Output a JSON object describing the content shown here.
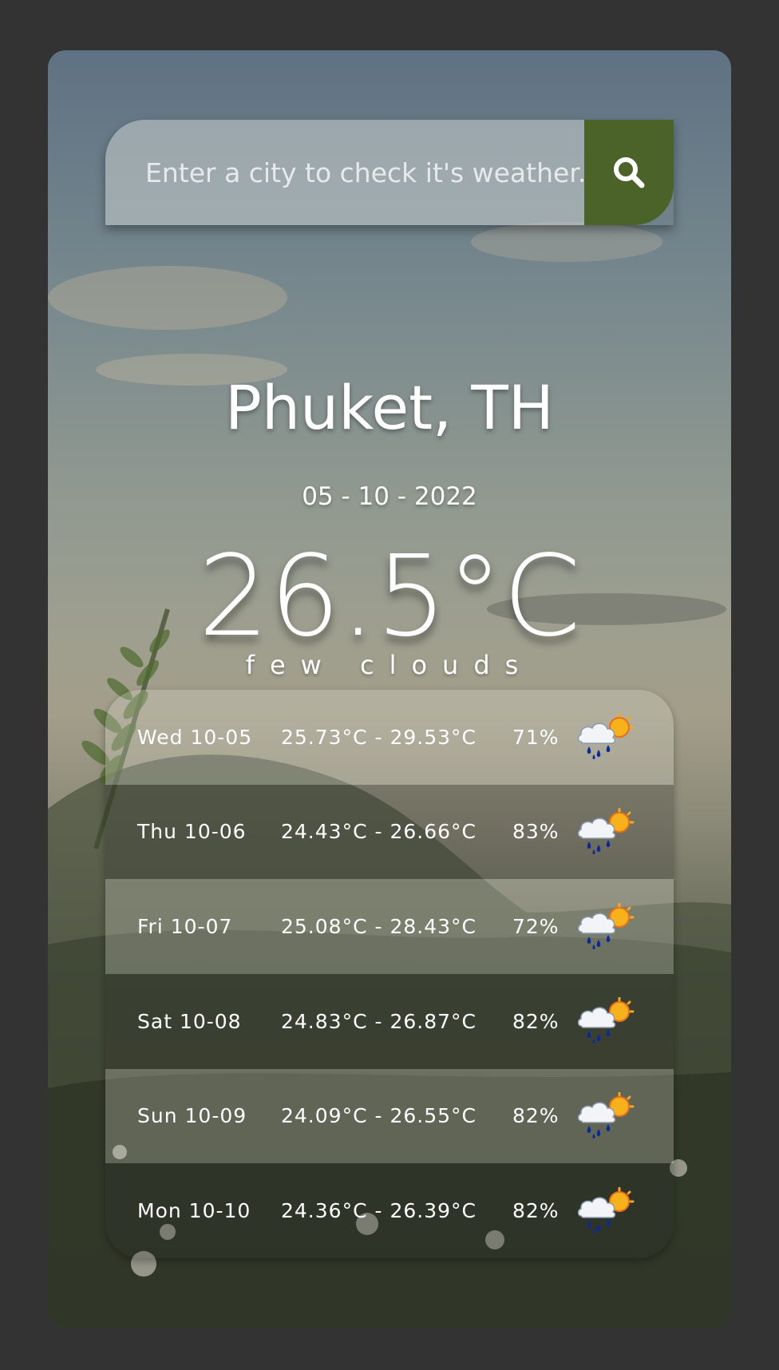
{
  "search": {
    "placeholder": "Enter a city to check it's weather...",
    "button_icon": "search-icon"
  },
  "current": {
    "city": "Phuket, TH",
    "date": "05 - 10 - 2022",
    "temperature": "26.5°C",
    "description": "few clouds"
  },
  "forecast": [
    {
      "day": "Wed 10-05",
      "range": "25.73°C - 29.53°C",
      "humidity": "71%",
      "icon": "rain-sun-icon"
    },
    {
      "day": "Thu 10-06",
      "range": "24.43°C - 26.66°C",
      "humidity": "83%",
      "icon": "rain-sun-icon"
    },
    {
      "day": "Fri 10-07",
      "range": "25.08°C - 28.43°C",
      "humidity": "72%",
      "icon": "rain-sun-icon"
    },
    {
      "day": "Sat 10-08",
      "range": "24.83°C - 26.87°C",
      "humidity": "82%",
      "icon": "rain-sun-icon"
    },
    {
      "day": "Sun 10-09",
      "range": "24.09°C - 26.55°C",
      "humidity": "82%",
      "icon": "rain-sun-icon"
    },
    {
      "day": "Mon 10-10",
      "range": "24.36°C - 26.39°C",
      "humidity": "82%",
      "icon": "rain-sun-icon"
    }
  ],
  "colors": {
    "page_background": "#333333",
    "search_button": "#4b6328",
    "text": "#ffffff"
  }
}
